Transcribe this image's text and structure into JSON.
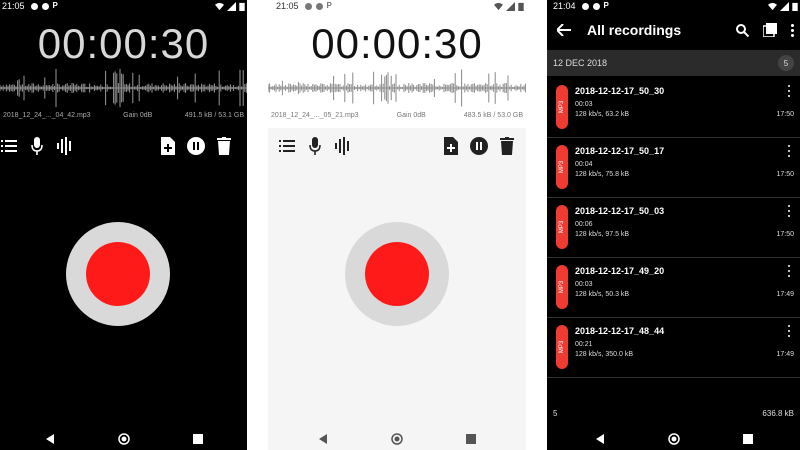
{
  "screen_dark": {
    "status_time": "21:05",
    "timer": "00:00:30",
    "file_name": "2018_12_24_..._04_42.mp3",
    "gain": "Gain 0dB",
    "storage": "491.5 kB / 53.1 GB",
    "toolbar_icons": [
      "list-icon",
      "mic-icon",
      "waveform-icon",
      "new-file-icon",
      "pause-icon",
      "delete-icon"
    ]
  },
  "screen_light": {
    "status_time": "21:05",
    "timer": "00:00:30",
    "file_name": "2018_12_24_..._05_21.mp3",
    "gain": "Gain 0dB",
    "storage": "483.5 kB / 53.0 GB",
    "toolbar_icons": [
      "list-icon",
      "mic-icon",
      "waveform-icon",
      "new-file-icon",
      "pause-icon",
      "delete-icon"
    ]
  },
  "screen_list": {
    "status_time": "21:04",
    "title": "All recordings",
    "section_date": "12 DEC 2018",
    "section_count": "5",
    "recordings": [
      {
        "name": "2018-12-12-17_50_30",
        "duration": "00:03",
        "info": "128 kb/s, 63.2 kB",
        "time": "17:50",
        "format": "MP3"
      },
      {
        "name": "2018-12-12-17_50_17",
        "duration": "00:04",
        "info": "128 kb/s, 75.8 kB",
        "time": "17:50",
        "format": "MP3"
      },
      {
        "name": "2018-12-12-17_50_03",
        "duration": "00:06",
        "info": "128 kb/s, 97.5 kB",
        "time": "17:50",
        "format": "MP3"
      },
      {
        "name": "2018-12-12-17_49_20",
        "duration": "00:03",
        "info": "128 kb/s, 50.3 kB",
        "time": "17:49",
        "format": "MP3"
      },
      {
        "name": "2018-12-12-17_48_44",
        "duration": "00:21",
        "info": "128 kb/s, 350.0 kB",
        "time": "17:49",
        "format": "MP3"
      }
    ],
    "footer_count": "5",
    "footer_size": "636.8 kB"
  },
  "colors": {
    "record_red": "#ff1a1a",
    "record_ring": "#d9d9d9",
    "badge_red": "#ef3b32"
  }
}
